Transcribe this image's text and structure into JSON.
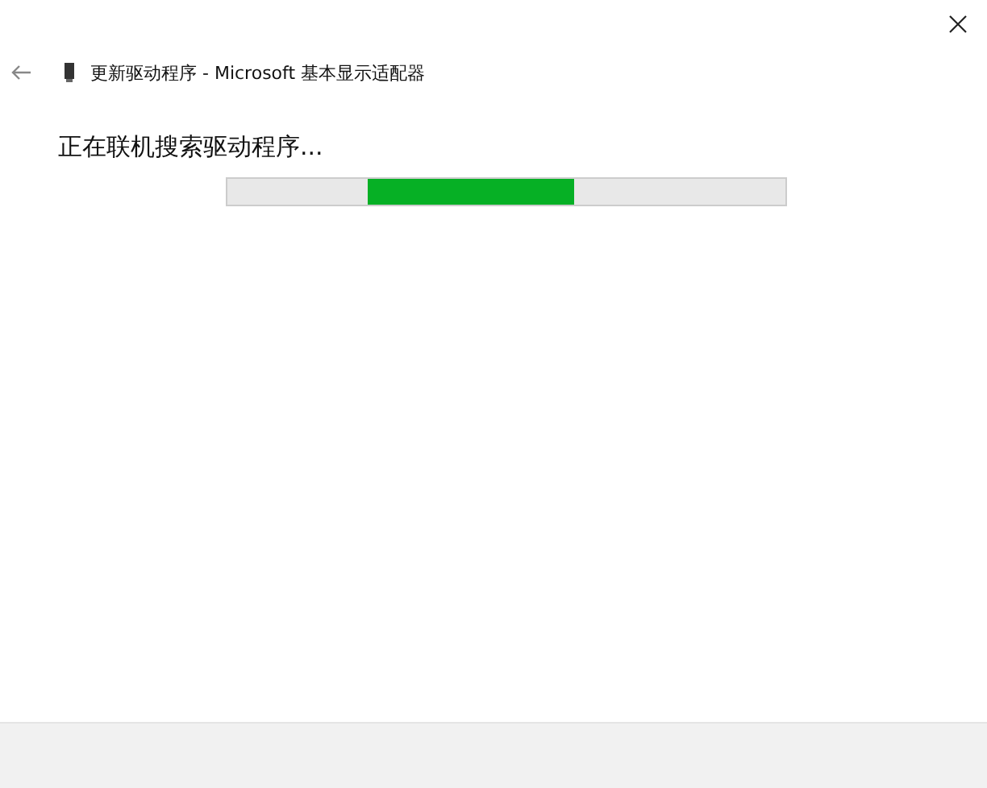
{
  "window": {
    "title": "更新驱动程序 - Microsoft 基本显示适配器"
  },
  "status": {
    "text": "正在联机搜索驱动程序..."
  },
  "progress": {
    "kind": "marquee",
    "level": 0.37
  }
}
